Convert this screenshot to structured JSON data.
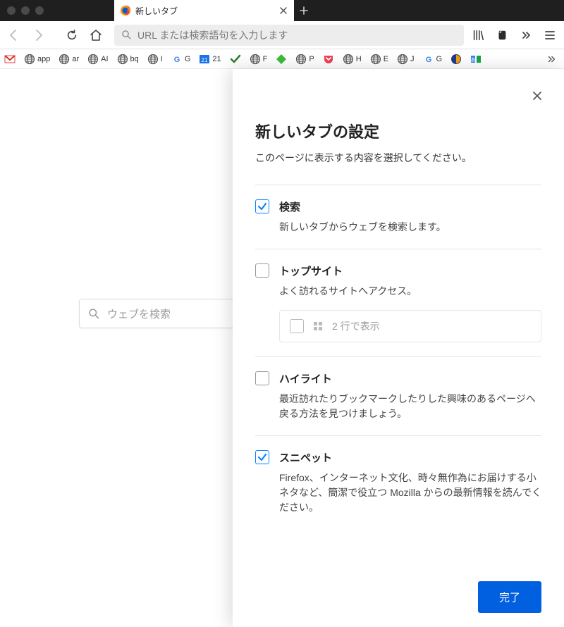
{
  "tab": {
    "title": "新しいタブ"
  },
  "urlbar": {
    "placeholder": "URL または検索語句を入力します"
  },
  "bookmarks": [
    {
      "label": "app",
      "icon": "globe"
    },
    {
      "label": "ar",
      "icon": "globe"
    },
    {
      "label": "AI",
      "icon": "globe"
    },
    {
      "label": "bq",
      "icon": "globe"
    },
    {
      "label": "I",
      "icon": "globe"
    },
    {
      "label": "G",
      "icon": "google"
    },
    {
      "label": "21",
      "icon": "calendar"
    },
    {
      "label": "",
      "icon": "check"
    },
    {
      "label": "F",
      "icon": "globe"
    },
    {
      "label": "",
      "icon": "diamond"
    },
    {
      "label": "P",
      "icon": "globe"
    },
    {
      "label": "",
      "icon": "pocket"
    },
    {
      "label": "H",
      "icon": "globe"
    },
    {
      "label": "E",
      "icon": "globe"
    },
    {
      "label": "J",
      "icon": "globe"
    },
    {
      "label": "G",
      "icon": "google"
    },
    {
      "label": "",
      "icon": "ext1"
    },
    {
      "label": "",
      "icon": "ext2"
    }
  ],
  "newtab_search": {
    "placeholder": "ウェブを検索"
  },
  "panel": {
    "title": "新しいタブの設定",
    "subtitle": "このページに表示する内容を選択してください。",
    "close_aria": "閉じる",
    "sections": [
      {
        "key": "search",
        "checked": true,
        "title": "検索",
        "desc": "新しいタブからウェブを検索します。"
      },
      {
        "key": "topsites",
        "checked": false,
        "title": "トップサイト",
        "desc": "よく訪れるサイトへアクセス。",
        "sub": {
          "checked": false,
          "label": "2 行で表示"
        }
      },
      {
        "key": "highlights",
        "checked": false,
        "title": "ハイライト",
        "desc": "最近訪れたりブックマークしたりした興味のあるページへ戻る方法を見つけましょう。"
      },
      {
        "key": "snippets",
        "checked": true,
        "title": "スニペット",
        "desc": "Firefox、インターネット文化、時々無作為にお届けする小ネタなど、簡潔で役立つ Mozilla からの最新情報を読んでください。"
      }
    ],
    "done": "完了"
  }
}
